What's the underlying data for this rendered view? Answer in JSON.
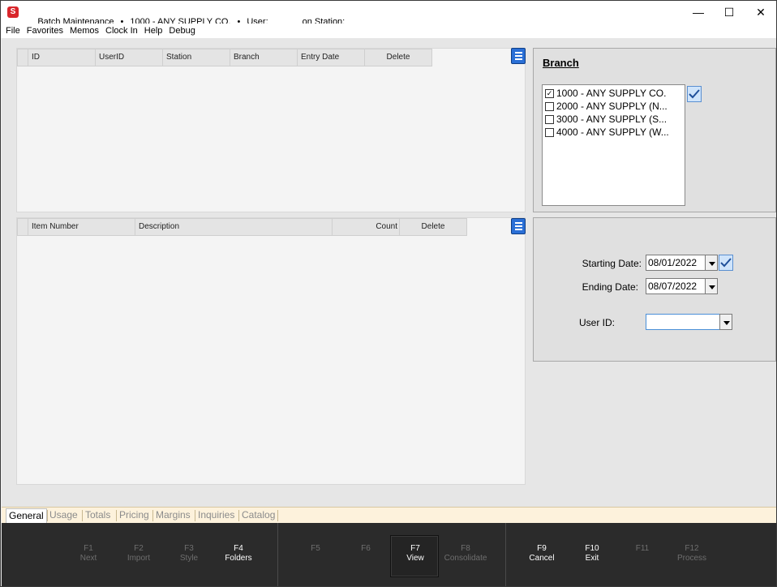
{
  "titlebar": {
    "app_icon_letter": "S",
    "title_parts": [
      "Batch Maintenance",
      "•",
      "1000 - ANY SUPPLY CO.",
      "•",
      "User:",
      "on Station:"
    ],
    "minimize": "—",
    "maximize": "☐",
    "close": "✕"
  },
  "menu": [
    "File",
    "Favorites",
    "Memos",
    "Clock In",
    "Help",
    "Debug"
  ],
  "batch_grid": {
    "columns": [
      "ID",
      "UserID",
      "Station",
      "Branch",
      "Entry Date",
      "Delete"
    ]
  },
  "items_grid": {
    "columns": [
      "Item Number",
      "Description",
      "Count",
      "Delete"
    ]
  },
  "branch_panel": {
    "title": "Branch",
    "items": [
      {
        "label": "1000 - ANY SUPPLY CO.",
        "checked": "✓"
      },
      {
        "label": "2000 - ANY SUPPLY (N...",
        "checked": ""
      },
      {
        "label": "3000 - ANY SUPPLY (S...",
        "checked": ""
      },
      {
        "label": "4000 - ANY SUPPLY (W...",
        "checked": ""
      }
    ]
  },
  "filters": {
    "starting_date_label": "Starting Date:",
    "starting_date": "08/01/2022",
    "ending_date_label": "Ending Date:",
    "ending_date": "08/07/2022",
    "user_id_label": "User ID:",
    "user_id": ""
  },
  "tabs": [
    "General",
    "Usage",
    "Totals",
    "Pricing",
    "Margins",
    "Inquiries",
    "Catalog"
  ],
  "fkeys": [
    {
      "key": "F1",
      "label": "Next"
    },
    {
      "key": "F2",
      "label": "Import"
    },
    {
      "key": "F3",
      "label": "Style"
    },
    {
      "key": "F4",
      "label": "Folders"
    },
    {
      "key": "F5",
      "label": ""
    },
    {
      "key": "F6",
      "label": ""
    },
    {
      "key": "F7",
      "label": "View"
    },
    {
      "key": "F8",
      "label": "Consolidate"
    },
    {
      "key": "F9",
      "label": "Cancel"
    },
    {
      "key": "F10",
      "label": "Exit"
    },
    {
      "key": "F11",
      "label": ""
    },
    {
      "key": "F12",
      "label": "Process"
    }
  ],
  "colors": {
    "accent_blue": "#2a6fd6",
    "fkey_bar": "#2b2b2b",
    "tab_strip": "#fdf2dc",
    "app_icon": "#d9262b"
  }
}
